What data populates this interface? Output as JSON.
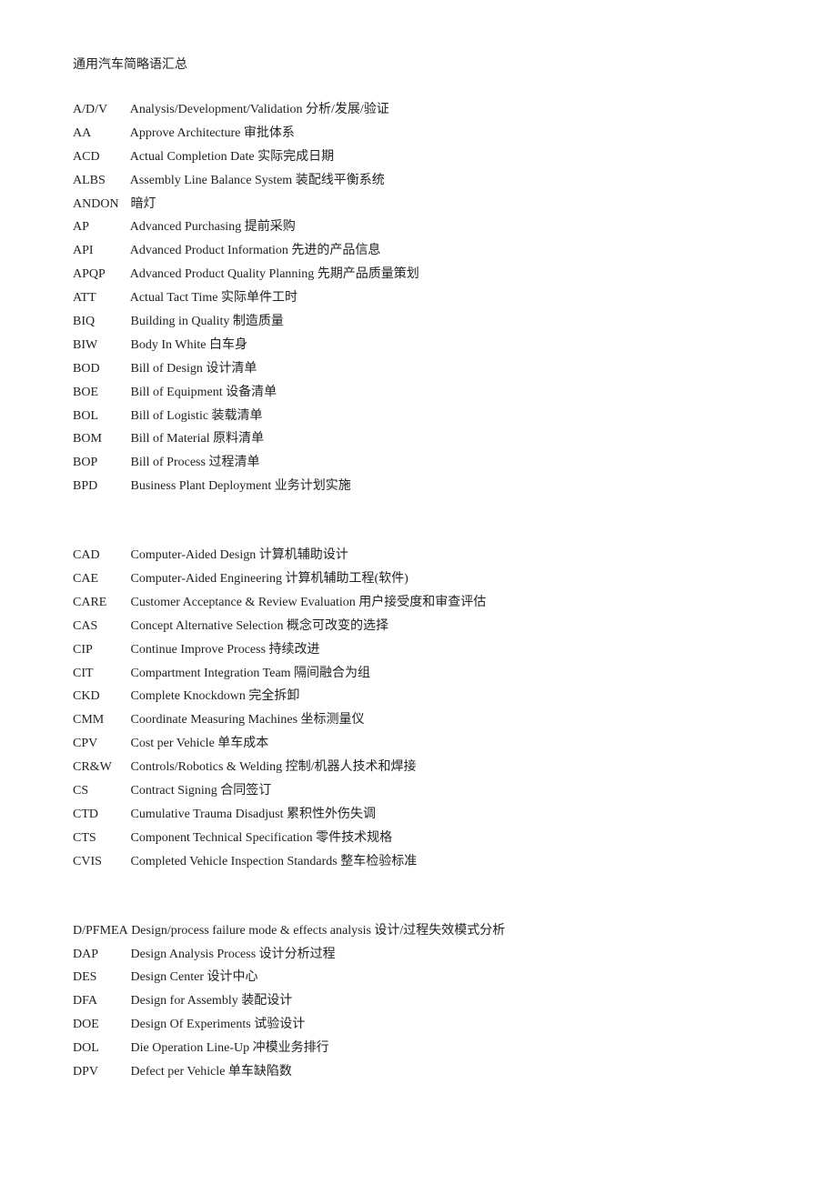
{
  "title": "通用汽车简略语汇总",
  "sections": [
    {
      "id": "A-B",
      "entries": [
        {
          "abbr": "A/D/V",
          "full": "Analysis/Development/Validation",
          "zh": "分析/发展/验证"
        },
        {
          "abbr": "AA",
          "full": "Approve Architecture",
          "zh": "审批体系"
        },
        {
          "abbr": "ACD",
          "full": "Actual Completion Date",
          "zh": "实际完成日期"
        },
        {
          "abbr": "ALBS",
          "full": "Assembly Line Balance System",
          "zh": "装配线平衡系统"
        },
        {
          "abbr": "ANDON",
          "full": "",
          "zh": "暗灯"
        },
        {
          "abbr": "AP",
          "full": "Advanced Purchasing",
          "zh": "提前采购"
        },
        {
          "abbr": "API",
          "full": "Advanced Product Information",
          "zh": "先进的产品信息"
        },
        {
          "abbr": "APQP",
          "full": "Advanced Product Quality Planning",
          "zh": "先期产品质量策划"
        },
        {
          "abbr": "ATT",
          "full": "Actual Tact Time",
          "zh": "实际单件工时"
        },
        {
          "abbr": "BIQ",
          "full": "Building in Quality",
          "zh": "制造质量"
        },
        {
          "abbr": "BIW",
          "full": "Body In White",
          "zh": "白车身"
        },
        {
          "abbr": "BOD",
          "full": "Bill of Design",
          "zh": "设计清单"
        },
        {
          "abbr": "BOE",
          "full": "Bill of Equipment",
          "zh": "设备清单"
        },
        {
          "abbr": "BOL",
          "full": "Bill of Logistic",
          "zh": "装载清单"
        },
        {
          "abbr": "BOM",
          "full": "Bill of Material",
          "zh": "原料清单"
        },
        {
          "abbr": "BOP",
          "full": "Bill of Process",
          "zh": "过程清单"
        },
        {
          "abbr": "BPD",
          "full": "Business Plant Deployment",
          "zh": "业务计划实施"
        }
      ]
    },
    {
      "id": "C",
      "entries": [
        {
          "abbr": "CAD",
          "full": "Computer-Aided Design",
          "zh": "计算机辅助设计"
        },
        {
          "abbr": "CAE",
          "full": "Computer-Aided Engineering",
          "zh": "计算机辅助工程(软件)"
        },
        {
          "abbr": "CARE",
          "full": "Customer Acceptance & Review Evaluation",
          "zh": "用户接受度和审查评估"
        },
        {
          "abbr": "CAS",
          "full": "Concept Alternative Selection",
          "zh": "概念可改变的选择"
        },
        {
          "abbr": "CIP",
          "full": "Continue Improve Process",
          "zh": "持续改进"
        },
        {
          "abbr": "CIT",
          "full": "Compartment Integration Team",
          "zh": "隔间融合为组"
        },
        {
          "abbr": "CKD",
          "full": "Complete Knockdown",
          "zh": "完全拆卸"
        },
        {
          "abbr": "CMM",
          "full": "Coordinate Measuring Machines",
          "zh": "坐标测量仪"
        },
        {
          "abbr": "CPV",
          "full": "Cost per Vehicle",
          "zh": "单车成本"
        },
        {
          "abbr": "CR&W",
          "full": "Controls/Robotics & Welding",
          "zh": "控制/机器人技术和焊接"
        },
        {
          "abbr": "CS",
          "full": "Contract Signing",
          "zh": "合同签订"
        },
        {
          "abbr": "CTD",
          "full": "Cumulative Trauma Disadjust",
          "zh": "累积性外伤失调"
        },
        {
          "abbr": "CTS",
          "full": "Component Technical Specification",
          "zh": "零件技术规格"
        },
        {
          "abbr": "CVIS",
          "full": "Completed Vehicle Inspection Standards",
          "zh": "整车检验标准"
        }
      ]
    },
    {
      "id": "D",
      "entries": [
        {
          "abbr": "D/PFMEA",
          "full": "Design/process failure mode & effects analysis",
          "zh": "设计/过程失效模式分析"
        },
        {
          "abbr": "DAP",
          "full": "Design Analysis Process",
          "zh": "设计分析过程"
        },
        {
          "abbr": "DES",
          "full": "Design Center",
          "zh": "设计中心"
        },
        {
          "abbr": "DFA",
          "full": "Design for Assembly",
          "zh": "装配设计"
        },
        {
          "abbr": "DOE",
          "full": "Design Of Experiments",
          "zh": "试验设计"
        },
        {
          "abbr": "DOL",
          "full": "Die Operation Line-Up",
          "zh": "冲模业务排行"
        },
        {
          "abbr": "DPV",
          "full": "Defect per Vehicle",
          "zh": "单车缺陷数"
        }
      ]
    }
  ]
}
